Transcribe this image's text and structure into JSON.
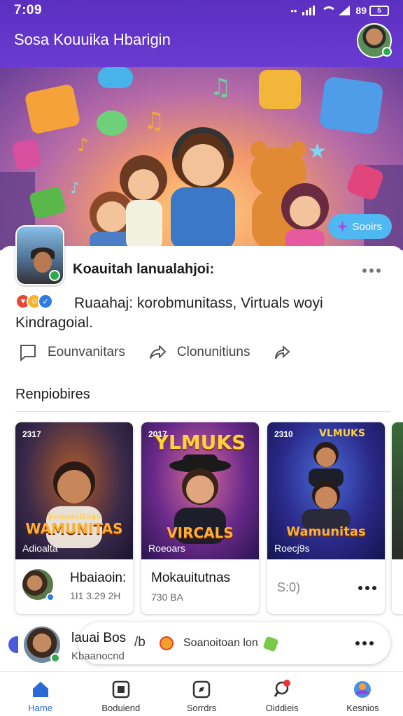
{
  "status_bar": {
    "time": "7:09",
    "battery": "89",
    "battery_box": "5"
  },
  "header": {
    "title": "Sosa Kouuika Hbarigin"
  },
  "hero": {
    "chip_label": "Sooirs"
  },
  "post": {
    "author": "Koauitah lanualahjoi:",
    "text": "Ruaahaj: korobmunitass, Virtuals woyi Kindragoial.",
    "actions": [
      {
        "label": "Eounvanitars",
        "icon": "comment-icon"
      },
      {
        "label": "Clonunitiuns",
        "icon": "share-icon"
      },
      {
        "label": "",
        "icon": "forward-icon"
      }
    ]
  },
  "section": {
    "title": "Renpiobires"
  },
  "tiles": [
    {
      "year": "2317",
      "banner_top": "",
      "banner_main": "WAMUNITAS",
      "banner_small": "Sunuacltoas",
      "caption": "Adioalta",
      "title": "Hbaiaoin:",
      "meta": "1I1 3.29 2H"
    },
    {
      "year": "2017",
      "banner_top": "YLMUKS",
      "banner_main": "VIRCALS",
      "banner_small": "",
      "caption": "Roeoars",
      "title": "Mokauitutnas",
      "meta": "730 BA"
    },
    {
      "year": "2310",
      "banner_top": "VLMUKS",
      "banner_main": "Wamunitas",
      "banner_small": "",
      "caption": "Roecj9s",
      "title": "",
      "meta": "S:0)"
    }
  ],
  "chat_row": {
    "name": "lauai Bos",
    "sub": "Kbaanocnd",
    "slash": "/b",
    "message": "Soanoitoan lon"
  },
  "nav": [
    {
      "label": "Hame",
      "icon": "home-icon"
    },
    {
      "label": "Boduiend",
      "icon": "square-icon"
    },
    {
      "label": "Sorrdrs",
      "icon": "compass-icon"
    },
    {
      "label": "Oiddieis",
      "icon": "notifications-icon"
    },
    {
      "label": "Kesnios",
      "icon": "globe-icon"
    }
  ],
  "colors": {
    "brand": "#5b2fc0",
    "accent": "#2a6ad6",
    "chip": "#4fb7f2",
    "verified": "#2ea84c"
  }
}
